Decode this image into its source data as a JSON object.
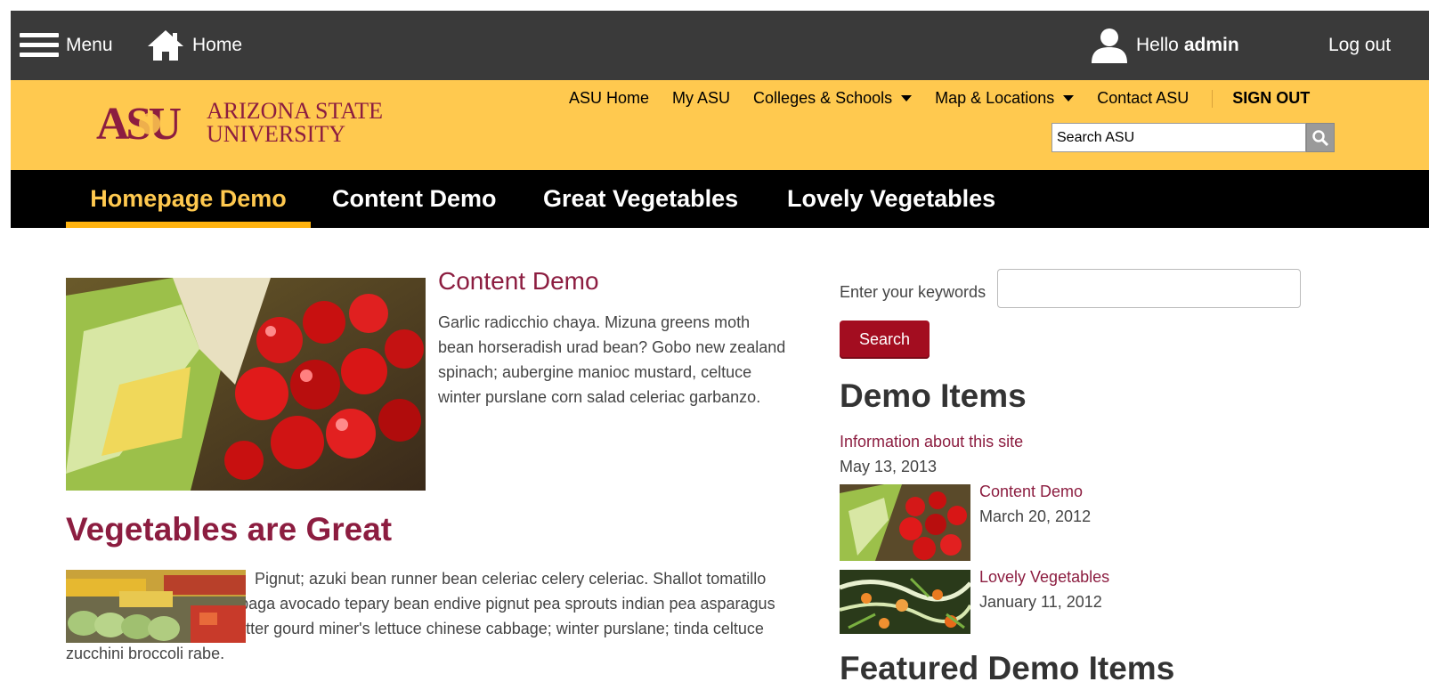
{
  "admin_bar": {
    "menu_label": "Menu",
    "home_label": "Home",
    "hello_text": "Hello",
    "username": "admin",
    "logout_label": "Log out"
  },
  "asu_header": {
    "logo_text_line1": "ARIZONA STATE",
    "logo_text_line2": "UNIVERSITY",
    "logo_mark": "ASU",
    "links": [
      "ASU Home",
      "My ASU",
      "Colleges & Schools",
      "Map & Locations",
      "Contact ASU"
    ],
    "signout_label": "SIGN OUT",
    "search_placeholder": "Search ASU",
    "colors": {
      "gold": "#ffc94f",
      "maroon": "#8c1d40"
    }
  },
  "main_nav": {
    "tabs": [
      {
        "label": "Homepage Demo",
        "active": true
      },
      {
        "label": "Content Demo",
        "active": false
      },
      {
        "label": "Great Vegetables",
        "active": false
      },
      {
        "label": "Lovely Vegetables",
        "active": false
      }
    ]
  },
  "main": {
    "content_demo": {
      "title": "Content Demo",
      "body": "Garlic radicchio chaya. Mizuna greens moth bean horseradish urad bean? Gobo new zealand spinach; aubergine manioc mustard, celtuce winter purslane corn salad celeriac garbanzo."
    },
    "vegetables": {
      "title": "Vegetables are Great",
      "body": "Pignut; azuki bean runner bean celeriac celery celeriac. Shallot tomatillo aubergine celeriac. Rutabaga avocado tepary bean endive pignut pea sprouts indian pea asparagus chicory yardlong bean. Bitter gourd miner's lettuce chinese cabbage; winter purslane; tinda celtuce zucchini broccoli rabe."
    }
  },
  "sidebar": {
    "keywords_label": "Enter your keywords",
    "search_button": "Search",
    "demo_items_heading": "Demo Items",
    "info_link": "Information about this site",
    "info_date": "May 13, 2013",
    "items": [
      {
        "title": "Content Demo",
        "date": "March 20, 2012"
      },
      {
        "title": "Lovely Vegetables",
        "date": "January 11, 2012"
      }
    ],
    "featured_heading": "Featured Demo Items"
  }
}
